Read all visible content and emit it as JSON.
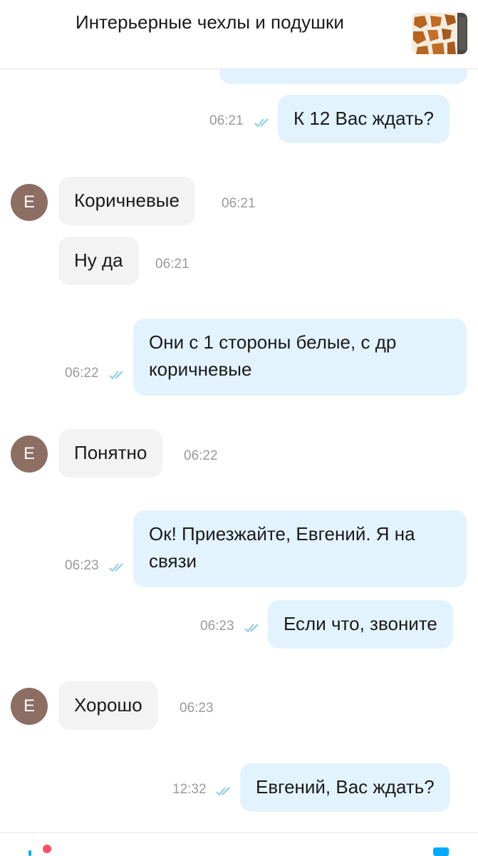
{
  "header": {
    "title": "Интерьерные чехлы и подушки"
  },
  "contact": {
    "avatar_letter": "Е"
  },
  "messages": [
    {
      "dir": "out",
      "text": "",
      "time": ""
    },
    {
      "dir": "out",
      "text": "К 12 Вас ждать?",
      "time": "06:21"
    },
    {
      "dir": "in",
      "text": "Коричневые",
      "time": "06:21"
    },
    {
      "dir": "in",
      "text": "Ну да",
      "time": "06:21"
    },
    {
      "dir": "out",
      "text": "Они с 1 стороны белые, с др коричневые",
      "time": "06:22"
    },
    {
      "dir": "in",
      "text": "Понятно",
      "time": "06:22"
    },
    {
      "dir": "out",
      "text": "Ок! Приезжайте, Евгений. Я на связи",
      "time": "06:23"
    },
    {
      "dir": "out",
      "text": "Если что, звоните",
      "time": "06:23"
    },
    {
      "dir": "in",
      "text": "Хорошо",
      "time": "06:23"
    },
    {
      "dir": "out",
      "text": "Евгений, Вас ждать?",
      "time": "12:32"
    }
  ],
  "colors": {
    "outgoing_bubble": "#e3f3fd",
    "incoming_bubble": "#f3f3f3",
    "avatar": "#8d6e63",
    "read_ticks": "#8ccbe8"
  },
  "icons": {
    "read": "double-check-icon",
    "nav_left": "profile-notification-icon",
    "nav_right": "messages-icon"
  }
}
